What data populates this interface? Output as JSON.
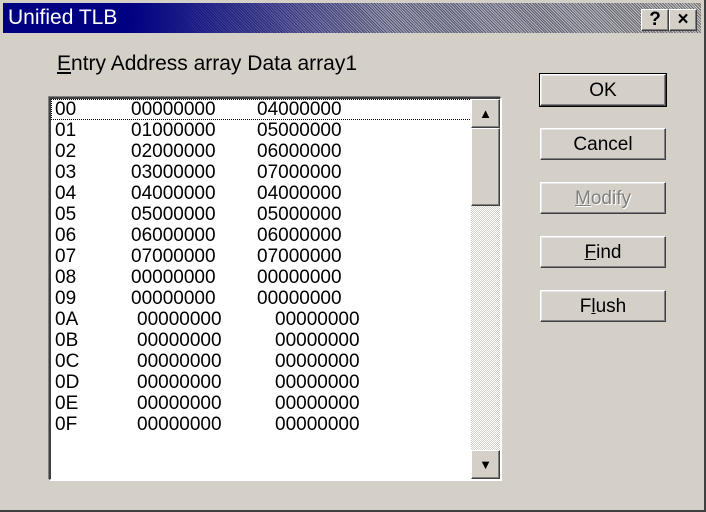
{
  "window": {
    "title": "Unified TLB",
    "help_label": "?",
    "close_label": "×"
  },
  "header": {
    "entry_label": "Entry",
    "address_label": "Address array",
    "data_label": "Data array1"
  },
  "rows": [
    {
      "entry": "00",
      "address": "00000000",
      "data": "04000000"
    },
    {
      "entry": "01",
      "address": "01000000",
      "data": "05000000"
    },
    {
      "entry": "02",
      "address": "02000000",
      "data": "06000000"
    },
    {
      "entry": "03",
      "address": "03000000",
      "data": "07000000"
    },
    {
      "entry": "04",
      "address": "04000000",
      "data": "04000000"
    },
    {
      "entry": "05",
      "address": "05000000",
      "data": "05000000"
    },
    {
      "entry": "06",
      "address": "06000000",
      "data": "06000000"
    },
    {
      "entry": "07",
      "address": "07000000",
      "data": "07000000"
    },
    {
      "entry": "08",
      "address": "00000000",
      "data": "00000000"
    },
    {
      "entry": "09",
      "address": "00000000",
      "data": "00000000"
    },
    {
      "entry": "0A",
      "address": "00000000",
      "data": "00000000"
    },
    {
      "entry": "0B",
      "address": "00000000",
      "data": "00000000"
    },
    {
      "entry": "0C",
      "address": "00000000",
      "data": "00000000"
    },
    {
      "entry": "0D",
      "address": "00000000",
      "data": "00000000"
    },
    {
      "entry": "0E",
      "address": "00000000",
      "data": "00000000"
    },
    {
      "entry": "0F",
      "address": "00000000",
      "data": "00000000"
    }
  ],
  "buttons": {
    "ok": "OK",
    "cancel": "Cancel",
    "modify": "Modify",
    "find": "Find",
    "flush": "Flush"
  },
  "scrollbar": {
    "up_icon": "scroll-up-arrow",
    "down_icon": "scroll-down-arrow"
  },
  "colors": {
    "titlebar": "#000082",
    "face": "#d4d0c8",
    "disabled_text": "#808080"
  }
}
